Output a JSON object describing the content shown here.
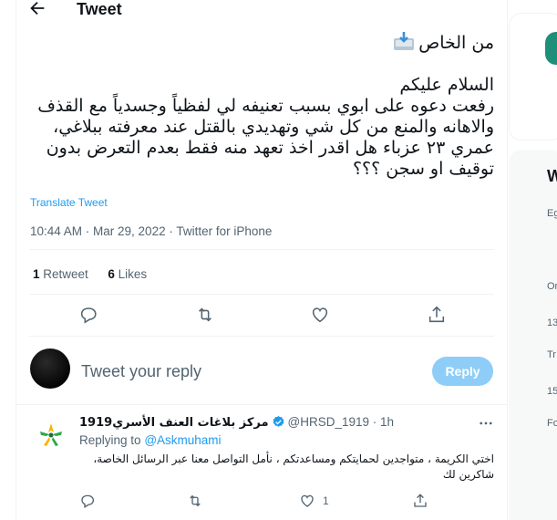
{
  "header": {
    "title": "Tweet"
  },
  "tweet": {
    "line1": "من الخاص",
    "line2": "السلام عليكم",
    "body": "رفعت دعوه على ابوي بسبب تعنيفه لي لفظياً وجسدياً مع القذف والاهانه والمنع من كل شي وتهديدي بالقتل عند معرفته ببلاغي، عمري ٢٣ عزباء هل اقدر اخذ تعهد منه فقط بعدم التعرض بدون توقيف او سجن ؟؟؟",
    "translate": "Translate Tweet",
    "meta": "10:44 AM · Mar 29, 2022 · Twitter for iPhone",
    "retweets_count": "1",
    "retweets_label": "Retweet",
    "likes_count": "6",
    "likes_label": "Likes"
  },
  "composer": {
    "placeholder": "Tweet your reply",
    "button": "Reply"
  },
  "reply": {
    "name": "مركز بلاغات العنف الأسري1919",
    "handle": "@HRSD_1919",
    "time": "· 1h",
    "replying_prefix": "Replying to",
    "replying_handle": "@Askmuhami",
    "text": "اختي الكريمة ، متواجدين لحمايتكم ومساعدتكم ، نأمل التواصل معنا عبر الرسائل الخاصة، شاكرين لك",
    "like_count": "1"
  },
  "right_column": {
    "w_letter": "W",
    "fragments": [
      "Eg",
      "Or",
      "13",
      "Tr",
      "15",
      "Fo"
    ]
  },
  "colors": {
    "accent": "#1d9bf0",
    "reply_button": "#8ecdf8",
    "muted": "#536471"
  }
}
